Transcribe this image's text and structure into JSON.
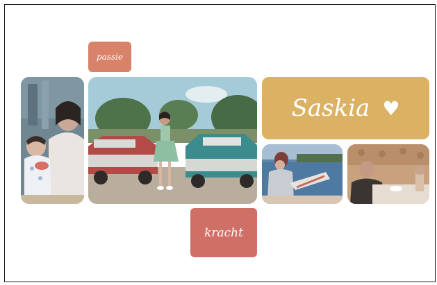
{
  "labels": {
    "passie": "passie",
    "kracht": "kracht"
  },
  "banner": {
    "name": "Saskia",
    "heart": "♥"
  },
  "photos": [
    {
      "id": "photo-mother-child"
    },
    {
      "id": "photo-cars-woman"
    },
    {
      "id": "photo-lake-child"
    },
    {
      "id": "photo-grandmother-table"
    }
  ],
  "colors": {
    "passie_tile": "#d9826a",
    "kracht_tile": "#d06f66",
    "banner": "#dbb163"
  }
}
